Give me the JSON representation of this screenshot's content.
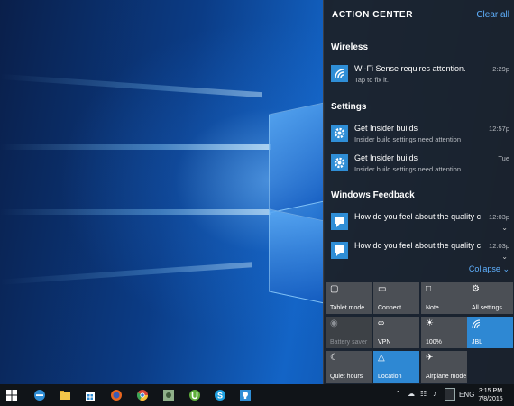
{
  "action_center": {
    "title": "ACTION CENTER",
    "clear_all": "Clear all",
    "groups": [
      {
        "name": "Wireless",
        "notifications": [
          {
            "title": "Wi-Fi Sense requires attention.",
            "subtitle": "Tap to fix it.",
            "time": "2:29p",
            "icon": "wifi-icon"
          }
        ]
      },
      {
        "name": "Settings",
        "notifications": [
          {
            "title": "Get Insider builds",
            "subtitle": "Insider build settings need attention",
            "time": "12:57p",
            "icon": "gear-icon"
          },
          {
            "title": "Get Insider builds",
            "subtitle": "Insider build settings need attention",
            "time": "Tue",
            "icon": "gear-icon"
          }
        ]
      },
      {
        "name": "Windows Feedback",
        "notifications": [
          {
            "title": "How do you feel about the quality c",
            "subtitle": "",
            "time": "12:03p",
            "icon": "feedback-icon"
          },
          {
            "title": "How do you feel about the quality c",
            "subtitle": "",
            "time": "12:03p",
            "icon": "feedback-icon"
          }
        ]
      }
    ],
    "collapse": "Collapse",
    "quick_actions": [
      {
        "label": "Tablet mode",
        "icon": "tablet-icon",
        "state": "off"
      },
      {
        "label": "Connect",
        "icon": "connect-icon",
        "state": "off"
      },
      {
        "label": "Note",
        "icon": "note-icon",
        "state": "off"
      },
      {
        "label": "All settings",
        "icon": "gear-icon",
        "state": "off"
      },
      {
        "label": "Battery saver",
        "icon": "battery-saver-icon",
        "state": "disabled"
      },
      {
        "label": "VPN",
        "icon": "vpn-icon",
        "state": "off"
      },
      {
        "label": "100%",
        "icon": "brightness-icon",
        "state": "off"
      },
      {
        "label": "JBL",
        "icon": "wifi-icon",
        "state": "on"
      },
      {
        "label": "Quiet hours",
        "icon": "moon-icon",
        "state": "off"
      },
      {
        "label": "Location",
        "icon": "location-icon",
        "state": "on"
      },
      {
        "label": "Airplane mode",
        "icon": "airplane-icon",
        "state": "off"
      }
    ]
  },
  "taskbar": {
    "apps": [
      "start-icon",
      "edge-icon",
      "file-explorer-icon",
      "store-icon",
      "firefox-icon",
      "chrome-icon",
      "app-icon",
      "utorrent-icon",
      "skype-icon",
      "tips-icon"
    ],
    "tray": {
      "language": "ENG",
      "time": "3:15 PM",
      "date": "7/8/2015"
    }
  },
  "colors": {
    "accent": "#2e88d3",
    "link": "#5fb1ff",
    "panel": "#1c2128",
    "taskbar": "#101418"
  }
}
